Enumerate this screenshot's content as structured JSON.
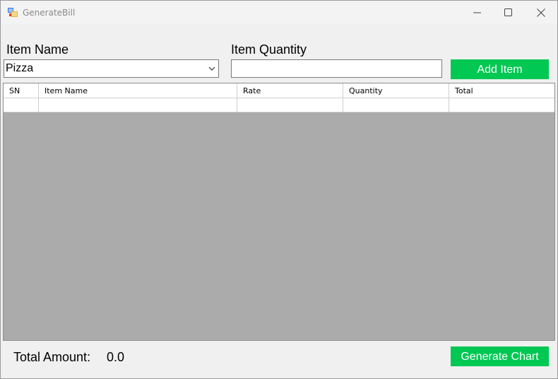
{
  "window": {
    "title": "GenerateBill",
    "icons": [
      "app-icon",
      "minimize-icon",
      "maximize-icon",
      "close-icon"
    ]
  },
  "form": {
    "item_name_label": "Item Name",
    "item_name_value": "Pizza",
    "item_quantity_label": "Item Quantity",
    "item_quantity_value": "",
    "add_button_label": "Add Item"
  },
  "grid": {
    "columns": [
      "SN",
      "Item Name",
      "Rate",
      "Quantity",
      "Total"
    ],
    "rows": [
      [
        "",
        "",
        "",
        "",
        ""
      ]
    ]
  },
  "footer": {
    "total_label": "Total Amount:",
    "total_value": "0.0",
    "chart_button_label": "Generate Chart"
  },
  "colors": {
    "accent_green": "#00c853",
    "grid_background": "#ababab"
  }
}
